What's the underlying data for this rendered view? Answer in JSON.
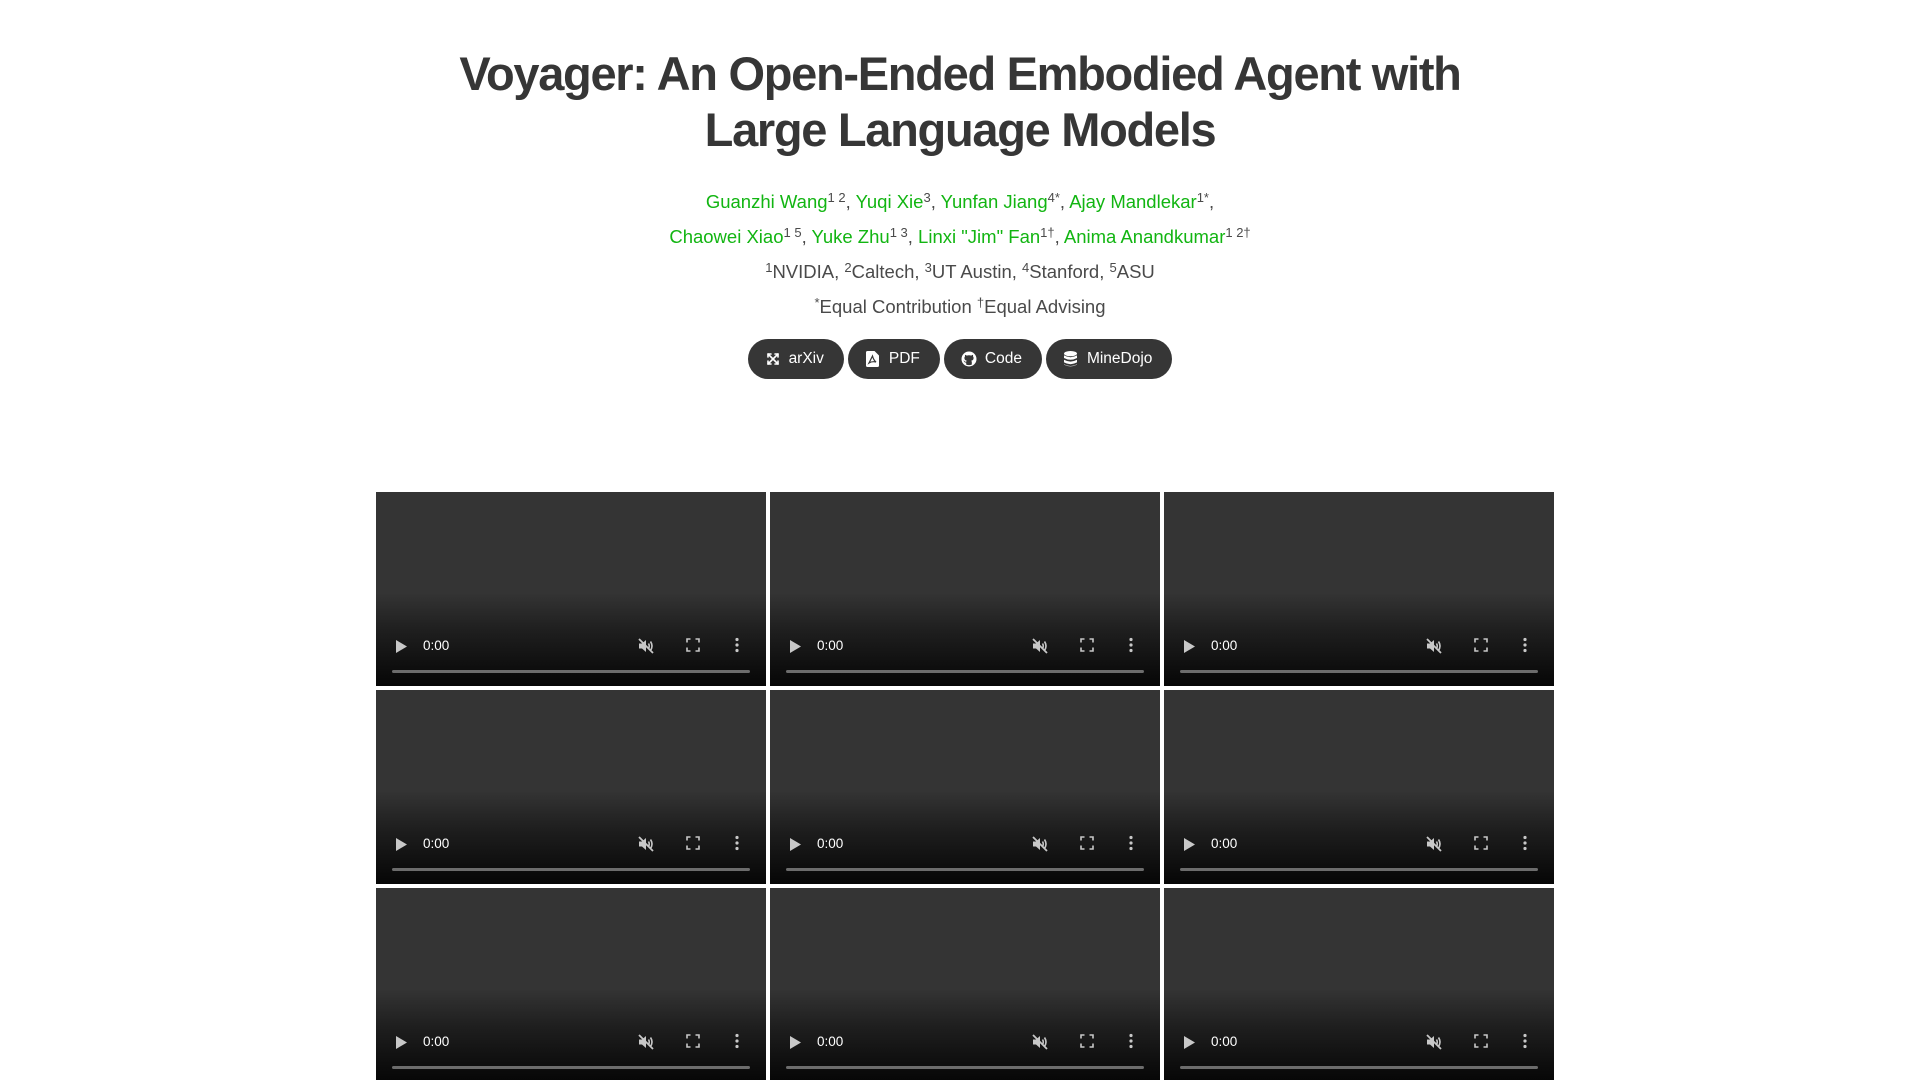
{
  "title": {
    "line1": "Voyager: An Open-Ended Embodied Agent with",
    "line2": "Large Language Models"
  },
  "authors": [
    {
      "name": "Guanzhi Wang",
      "sup": "1 2"
    },
    {
      "name": "Yuqi Xie",
      "sup": "3"
    },
    {
      "name": "Yunfan Jiang",
      "sup": "4*"
    },
    {
      "name": "Ajay Mandlekar",
      "sup": "1*"
    },
    {
      "name": "Chaowei Xiao",
      "sup": "1 5"
    },
    {
      "name": "Yuke Zhu",
      "sup": "1 3"
    },
    {
      "name": "Linxi \"Jim\" Fan",
      "sup": "1†"
    },
    {
      "name": "Anima Anandkumar",
      "sup": "1 2†"
    }
  ],
  "affiliations": [
    {
      "sup": "1",
      "name": "NVIDIA"
    },
    {
      "sup": "2",
      "name": "Caltech"
    },
    {
      "sup": "3",
      "name": "UT Austin"
    },
    {
      "sup": "4",
      "name": "Stanford"
    },
    {
      "sup": "5",
      "name": "ASU"
    }
  ],
  "notes": [
    {
      "sup": "*",
      "text": "Equal Contribution"
    },
    {
      "sup": "†",
      "text": "Equal Advising"
    }
  ],
  "links": [
    {
      "label": "arXiv",
      "icon": "arxiv-icon"
    },
    {
      "label": "PDF",
      "icon": "file-pdf-icon"
    },
    {
      "label": "Code",
      "icon": "github-icon"
    },
    {
      "label": "MineDojo",
      "icon": "database-icon"
    }
  ],
  "videos": [
    {
      "time": "0:00",
      "progress": 0,
      "muted": true
    },
    {
      "time": "0:00",
      "progress": 0,
      "muted": true
    },
    {
      "time": "0:00",
      "progress": 0,
      "muted": true
    },
    {
      "time": "0:00",
      "progress": 0,
      "muted": true
    },
    {
      "time": "0:00",
      "progress": 0,
      "muted": true
    },
    {
      "time": "0:00",
      "progress": 0,
      "muted": true
    },
    {
      "time": "0:00",
      "progress": 0,
      "muted": true
    },
    {
      "time": "0:00",
      "progress": 0,
      "muted": true
    },
    {
      "time": "0:00",
      "progress": 0,
      "muted": true
    }
  ],
  "colors": {
    "author_link": "#12b512",
    "button_bg": "#363636",
    "title": "#363636"
  }
}
